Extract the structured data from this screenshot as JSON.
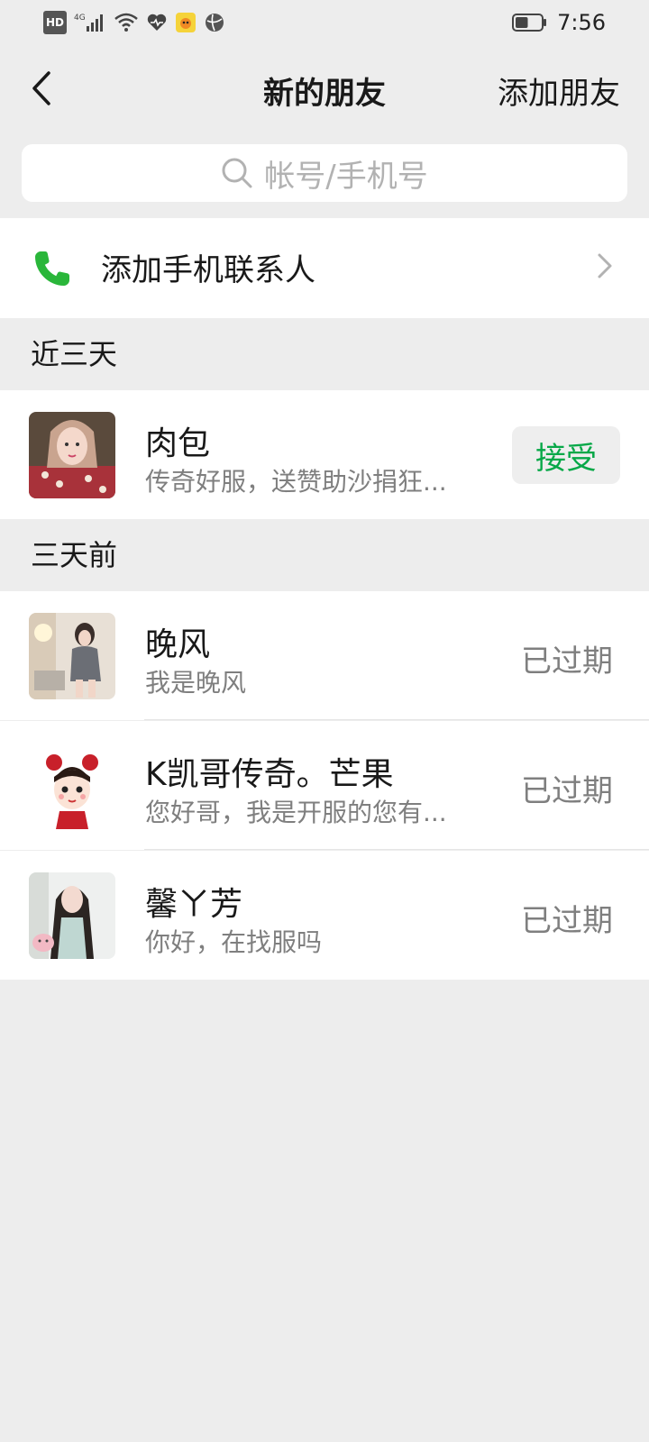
{
  "status_bar": {
    "hd_label": "HD",
    "network_label": "4G",
    "battery_level": 0.5,
    "time": "7:56"
  },
  "nav": {
    "title": "新的朋友",
    "action_label": "添加朋友"
  },
  "search": {
    "placeholder": "帐号/手机号"
  },
  "add_phone_contacts": {
    "label": "添加手机联系人",
    "icon_color": "#2ab63a"
  },
  "sections": [
    {
      "header": "近三天",
      "items": [
        {
          "name": "肉包",
          "message": "传奇好服，送赞助沙捐狂...",
          "action": "接受",
          "action_type": "button"
        }
      ]
    },
    {
      "header": "三天前",
      "items": [
        {
          "name": "晚风",
          "message": "我是晚风",
          "action": "已过期",
          "action_type": "status"
        },
        {
          "name": "K凯哥传奇。芒果",
          "message": "您好哥，我是开服的您有...",
          "action": "已过期",
          "action_type": "status"
        },
        {
          "name": "馨ㄚ芳",
          "message": "你好，在找服吗",
          "action": "已过期",
          "action_type": "status"
        }
      ]
    }
  ],
  "colors": {
    "accent_green": "#07a848",
    "background": "#ededed",
    "secondary_text": "#7f7f7f"
  }
}
